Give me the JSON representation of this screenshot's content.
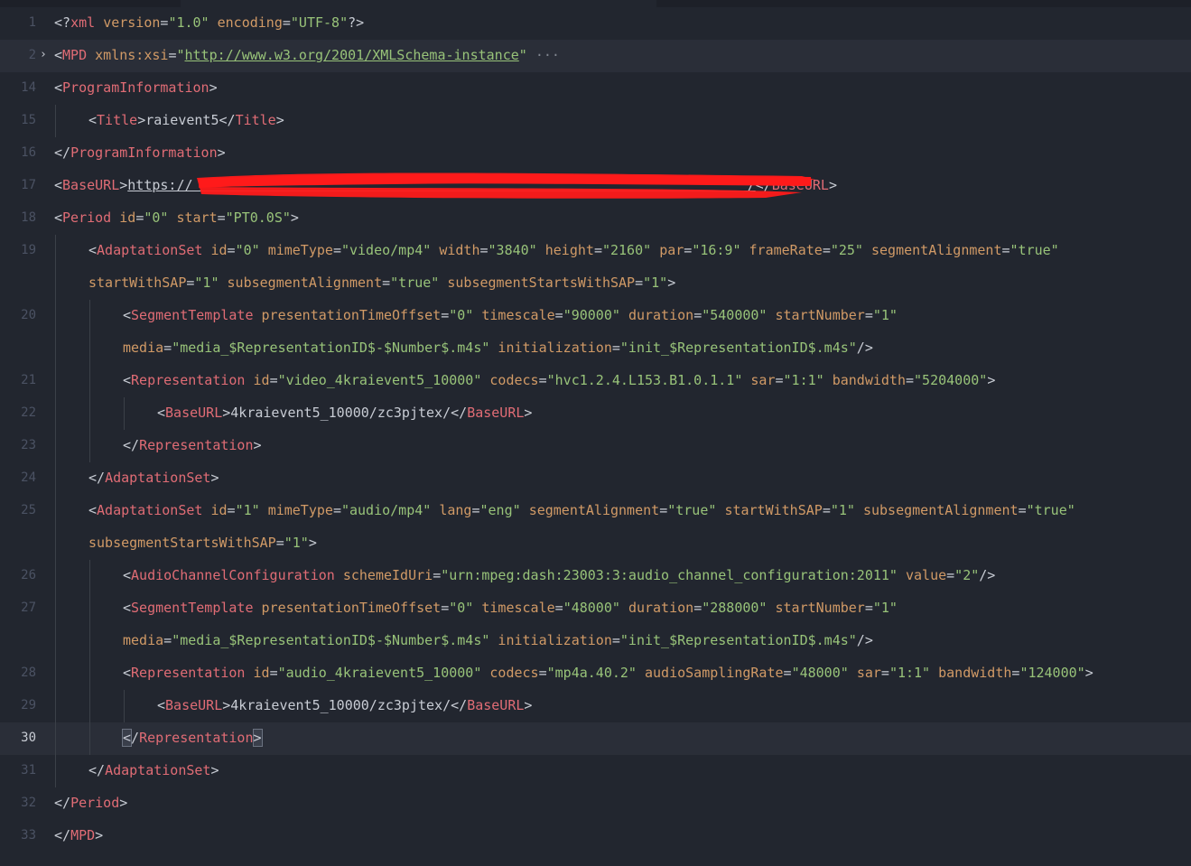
{
  "editor": {
    "lines": [
      {
        "n": "1",
        "tokens": [
          [
            "punc",
            "<?"
          ],
          [
            "tag",
            "xml"
          ],
          [
            "punc",
            " "
          ],
          [
            "attr",
            "version"
          ],
          [
            "punc",
            "="
          ],
          [
            "str",
            "\"1.0\""
          ],
          [
            "punc",
            " "
          ],
          [
            "attr",
            "encoding"
          ],
          [
            "punc",
            "="
          ],
          [
            "str",
            "\"UTF-8\""
          ],
          [
            "punc",
            "?>"
          ]
        ]
      },
      {
        "n": "2",
        "fold": "›",
        "hover": true,
        "tokens": [
          [
            "punc",
            "<"
          ],
          [
            "tag",
            "MPD"
          ],
          [
            "punc",
            " "
          ],
          [
            "attr",
            "xmlns:xsi"
          ],
          [
            "punc",
            "="
          ],
          [
            "str",
            "\""
          ],
          [
            "strlink",
            "http://www.w3.org/2001/XMLSchema-instance"
          ],
          [
            "str",
            "\""
          ],
          [
            "ell",
            " ···"
          ]
        ]
      },
      {
        "n": "14",
        "tokens": [
          [
            "punc",
            "<"
          ],
          [
            "tag",
            "ProgramInformation"
          ],
          [
            "punc",
            ">"
          ]
        ]
      },
      {
        "n": "15",
        "indent": 1,
        "tokens": [
          [
            "punc",
            "<"
          ],
          [
            "tag",
            "Title"
          ],
          [
            "punc",
            ">"
          ],
          [
            "text",
            "raievent5"
          ],
          [
            "punc",
            "</"
          ],
          [
            "tag",
            "Title"
          ],
          [
            "punc",
            ">"
          ]
        ]
      },
      {
        "n": "16",
        "tokens": [
          [
            "punc",
            "</"
          ],
          [
            "tag",
            "ProgramInformation"
          ],
          [
            "punc",
            ">"
          ]
        ]
      },
      {
        "n": "17",
        "tokens": [
          [
            "punc",
            "<"
          ],
          [
            "tag",
            "BaseURL"
          ],
          [
            "punc",
            ">"
          ],
          [
            "textlink",
            "https://                                                                    /"
          ],
          [
            "punc",
            "</"
          ],
          [
            "tag",
            "BaseURL"
          ],
          [
            "punc",
            ">"
          ]
        ]
      },
      {
        "n": "18",
        "tokens": [
          [
            "punc",
            "<"
          ],
          [
            "tag",
            "Period"
          ],
          [
            "punc",
            " "
          ],
          [
            "attr",
            "id"
          ],
          [
            "punc",
            "="
          ],
          [
            "str",
            "\"0\""
          ],
          [
            "punc",
            " "
          ],
          [
            "attr",
            "start"
          ],
          [
            "punc",
            "="
          ],
          [
            "str",
            "\"PT0.0S\""
          ],
          [
            "punc",
            ">"
          ]
        ]
      },
      {
        "n": "19",
        "indent": 1,
        "tokens": [
          [
            "punc",
            "<"
          ],
          [
            "tag",
            "AdaptationSet"
          ],
          [
            "punc",
            " "
          ],
          [
            "attr",
            "id"
          ],
          [
            "punc",
            "="
          ],
          [
            "str",
            "\"0\""
          ],
          [
            "punc",
            " "
          ],
          [
            "attr",
            "mimeType"
          ],
          [
            "punc",
            "="
          ],
          [
            "str",
            "\"video/mp4\""
          ],
          [
            "punc",
            " "
          ],
          [
            "attr",
            "width"
          ],
          [
            "punc",
            "="
          ],
          [
            "str",
            "\"3840\""
          ],
          [
            "punc",
            " "
          ],
          [
            "attr",
            "height"
          ],
          [
            "punc",
            "="
          ],
          [
            "str",
            "\"2160\""
          ],
          [
            "punc",
            " "
          ],
          [
            "attr",
            "par"
          ],
          [
            "punc",
            "="
          ],
          [
            "str",
            "\"16:9\""
          ],
          [
            "punc",
            " "
          ],
          [
            "attr",
            "frameRate"
          ],
          [
            "punc",
            "="
          ],
          [
            "str",
            "\"25\""
          ],
          [
            "punc",
            " "
          ],
          [
            "attr",
            "segmentAlignment"
          ],
          [
            "punc",
            "="
          ],
          [
            "str",
            "\"true\""
          ]
        ]
      },
      {
        "n": "",
        "indent": 1,
        "tokens": [
          [
            "attr",
            "startWithSAP"
          ],
          [
            "punc",
            "="
          ],
          [
            "str",
            "\"1\""
          ],
          [
            "punc",
            " "
          ],
          [
            "attr",
            "subsegmentAlignment"
          ],
          [
            "punc",
            "="
          ],
          [
            "str",
            "\"true\""
          ],
          [
            "punc",
            " "
          ],
          [
            "attr",
            "subsegmentStartsWithSAP"
          ],
          [
            "punc",
            "="
          ],
          [
            "str",
            "\"1\""
          ],
          [
            "punc",
            ">"
          ]
        ]
      },
      {
        "n": "20",
        "indent": 2,
        "tokens": [
          [
            "punc",
            "<"
          ],
          [
            "tag",
            "SegmentTemplate"
          ],
          [
            "punc",
            " "
          ],
          [
            "attr",
            "presentationTimeOffset"
          ],
          [
            "punc",
            "="
          ],
          [
            "str",
            "\"0\""
          ],
          [
            "punc",
            " "
          ],
          [
            "attr",
            "timescale"
          ],
          [
            "punc",
            "="
          ],
          [
            "str",
            "\"90000\""
          ],
          [
            "punc",
            " "
          ],
          [
            "attr",
            "duration"
          ],
          [
            "punc",
            "="
          ],
          [
            "str",
            "\"540000\""
          ],
          [
            "punc",
            " "
          ],
          [
            "attr",
            "startNumber"
          ],
          [
            "punc",
            "="
          ],
          [
            "str",
            "\"1\""
          ]
        ]
      },
      {
        "n": "",
        "indent": 2,
        "tokens": [
          [
            "attr",
            "media"
          ],
          [
            "punc",
            "="
          ],
          [
            "str",
            "\"media_$RepresentationID$-$Number$.m4s\""
          ],
          [
            "punc",
            " "
          ],
          [
            "attr",
            "initialization"
          ],
          [
            "punc",
            "="
          ],
          [
            "str",
            "\"init_$RepresentationID$.m4s\""
          ],
          [
            "punc",
            "/>"
          ]
        ]
      },
      {
        "n": "21",
        "indent": 2,
        "tokens": [
          [
            "punc",
            "<"
          ],
          [
            "tag",
            "Representation"
          ],
          [
            "punc",
            " "
          ],
          [
            "attr",
            "id"
          ],
          [
            "punc",
            "="
          ],
          [
            "str",
            "\"video_4kraievent5_10000\""
          ],
          [
            "punc",
            " "
          ],
          [
            "attr",
            "codecs"
          ],
          [
            "punc",
            "="
          ],
          [
            "str",
            "\"hvc1.2.4.L153.B1.0.1.1\""
          ],
          [
            "punc",
            " "
          ],
          [
            "attr",
            "sar"
          ],
          [
            "punc",
            "="
          ],
          [
            "str",
            "\"1:1\""
          ],
          [
            "punc",
            " "
          ],
          [
            "attr",
            "bandwidth"
          ],
          [
            "punc",
            "="
          ],
          [
            "str",
            "\"5204000\""
          ],
          [
            "punc",
            ">"
          ]
        ]
      },
      {
        "n": "22",
        "indent": 3,
        "tokens": [
          [
            "punc",
            "<"
          ],
          [
            "tag",
            "BaseURL"
          ],
          [
            "punc",
            ">"
          ],
          [
            "text",
            "4kraievent5_10000/zc3pjtex/"
          ],
          [
            "punc",
            "</"
          ],
          [
            "tag",
            "BaseURL"
          ],
          [
            "punc",
            ">"
          ]
        ]
      },
      {
        "n": "23",
        "indent": 2,
        "tokens": [
          [
            "punc",
            "</"
          ],
          [
            "tag",
            "Representation"
          ],
          [
            "punc",
            ">"
          ]
        ]
      },
      {
        "n": "24",
        "indent": 1,
        "tokens": [
          [
            "punc",
            "</"
          ],
          [
            "tag",
            "AdaptationSet"
          ],
          [
            "punc",
            ">"
          ]
        ]
      },
      {
        "n": "25",
        "indent": 1,
        "tokens": [
          [
            "punc",
            "<"
          ],
          [
            "tag",
            "AdaptationSet"
          ],
          [
            "punc",
            " "
          ],
          [
            "attr",
            "id"
          ],
          [
            "punc",
            "="
          ],
          [
            "str",
            "\"1\""
          ],
          [
            "punc",
            " "
          ],
          [
            "attr",
            "mimeType"
          ],
          [
            "punc",
            "="
          ],
          [
            "str",
            "\"audio/mp4\""
          ],
          [
            "punc",
            " "
          ],
          [
            "attr",
            "lang"
          ],
          [
            "punc",
            "="
          ],
          [
            "str",
            "\"eng\""
          ],
          [
            "punc",
            " "
          ],
          [
            "attr",
            "segmentAlignment"
          ],
          [
            "punc",
            "="
          ],
          [
            "str",
            "\"true\""
          ],
          [
            "punc",
            " "
          ],
          [
            "attr",
            "startWithSAP"
          ],
          [
            "punc",
            "="
          ],
          [
            "str",
            "\"1\""
          ],
          [
            "punc",
            " "
          ],
          [
            "attr",
            "subsegmentAlignment"
          ],
          [
            "punc",
            "="
          ],
          [
            "str",
            "\"true\""
          ]
        ]
      },
      {
        "n": "",
        "indent": 1,
        "tokens": [
          [
            "attr",
            "subsegmentStartsWithSAP"
          ],
          [
            "punc",
            "="
          ],
          [
            "str",
            "\"1\""
          ],
          [
            "punc",
            ">"
          ]
        ]
      },
      {
        "n": "26",
        "indent": 2,
        "tokens": [
          [
            "punc",
            "<"
          ],
          [
            "tag",
            "AudioChannelConfiguration"
          ],
          [
            "punc",
            " "
          ],
          [
            "attr",
            "schemeIdUri"
          ],
          [
            "punc",
            "="
          ],
          [
            "str",
            "\"urn:mpeg:dash:23003:3:audio_channel_configuration:2011\""
          ],
          [
            "punc",
            " "
          ],
          [
            "attr",
            "value"
          ],
          [
            "punc",
            "="
          ],
          [
            "str",
            "\"2\""
          ],
          [
            "punc",
            "/>"
          ]
        ]
      },
      {
        "n": "27",
        "indent": 2,
        "tokens": [
          [
            "punc",
            "<"
          ],
          [
            "tag",
            "SegmentTemplate"
          ],
          [
            "punc",
            " "
          ],
          [
            "attr",
            "presentationTimeOffset"
          ],
          [
            "punc",
            "="
          ],
          [
            "str",
            "\"0\""
          ],
          [
            "punc",
            " "
          ],
          [
            "attr",
            "timescale"
          ],
          [
            "punc",
            "="
          ],
          [
            "str",
            "\"48000\""
          ],
          [
            "punc",
            " "
          ],
          [
            "attr",
            "duration"
          ],
          [
            "punc",
            "="
          ],
          [
            "str",
            "\"288000\""
          ],
          [
            "punc",
            " "
          ],
          [
            "attr",
            "startNumber"
          ],
          [
            "punc",
            "="
          ],
          [
            "str",
            "\"1\""
          ]
        ]
      },
      {
        "n": "",
        "indent": 2,
        "tokens": [
          [
            "attr",
            "media"
          ],
          [
            "punc",
            "="
          ],
          [
            "str",
            "\"media_$RepresentationID$-$Number$.m4s\""
          ],
          [
            "punc",
            " "
          ],
          [
            "attr",
            "initialization"
          ],
          [
            "punc",
            "="
          ],
          [
            "str",
            "\"init_$RepresentationID$.m4s\""
          ],
          [
            "punc",
            "/>"
          ]
        ]
      },
      {
        "n": "28",
        "indent": 2,
        "tokens": [
          [
            "punc",
            "<"
          ],
          [
            "tag",
            "Representation"
          ],
          [
            "punc",
            " "
          ],
          [
            "attr",
            "id"
          ],
          [
            "punc",
            "="
          ],
          [
            "str",
            "\"audio_4kraievent5_10000\""
          ],
          [
            "punc",
            " "
          ],
          [
            "attr",
            "codecs"
          ],
          [
            "punc",
            "="
          ],
          [
            "str",
            "\"mp4a.40.2\""
          ],
          [
            "punc",
            " "
          ],
          [
            "attr",
            "audioSamplingRate"
          ],
          [
            "punc",
            "="
          ],
          [
            "str",
            "\"48000\""
          ],
          [
            "punc",
            " "
          ],
          [
            "attr",
            "sar"
          ],
          [
            "punc",
            "="
          ],
          [
            "str",
            "\"1:1\""
          ],
          [
            "punc",
            " "
          ],
          [
            "attr",
            "bandwidth"
          ],
          [
            "punc",
            "="
          ],
          [
            "str",
            "\"124000\""
          ],
          [
            "punc",
            ">"
          ]
        ]
      },
      {
        "n": "29",
        "indent": 3,
        "tokens": [
          [
            "punc",
            "<"
          ],
          [
            "tag",
            "BaseURL"
          ],
          [
            "punc",
            ">"
          ],
          [
            "text",
            "4kraievent5_10000/zc3pjtex/"
          ],
          [
            "punc",
            "</"
          ],
          [
            "tag",
            "BaseURL"
          ],
          [
            "punc",
            ">"
          ]
        ]
      },
      {
        "n": "30",
        "indent": 2,
        "current": true,
        "tokens": [
          [
            "punchl",
            "<"
          ],
          [
            "punc",
            "/"
          ],
          [
            "tag",
            "Representation"
          ],
          [
            "punchl",
            ">"
          ]
        ]
      },
      {
        "n": "31",
        "indent": 1,
        "tokens": [
          [
            "punc",
            "</"
          ],
          [
            "tag",
            "AdaptationSet"
          ],
          [
            "punc",
            ">"
          ]
        ]
      },
      {
        "n": "32",
        "tokens": [
          [
            "punc",
            "</"
          ],
          [
            "tag",
            "Period"
          ],
          [
            "punc",
            ">"
          ]
        ]
      },
      {
        "n": "33",
        "tokens": [
          [
            "punc",
            "</"
          ],
          [
            "tag",
            "MPD"
          ],
          [
            "punc",
            ">"
          ]
        ]
      }
    ]
  },
  "colors": {
    "background": "#22262f",
    "tag": "#e06c75",
    "attribute": "#d19a66",
    "string": "#98c379",
    "redaction": "#ff1a1a"
  }
}
